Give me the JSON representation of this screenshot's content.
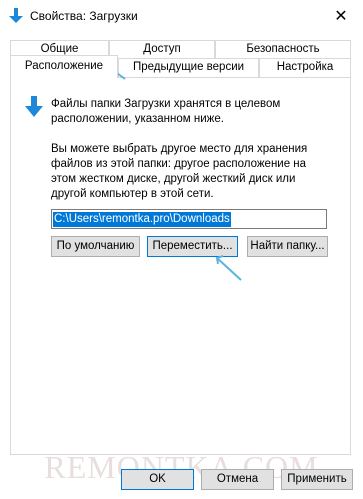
{
  "window": {
    "title": "Свойства: Загрузки",
    "close_glyph": "✕"
  },
  "tabs": {
    "row1": [
      "Общие",
      "Доступ",
      "Безопасность"
    ],
    "row2": [
      "Предыдущие версии",
      "Настройка"
    ],
    "active": "Расположение"
  },
  "content": {
    "info": "Файлы папки Загрузки хранятся в целевом расположении, указанном ниже.",
    "description": "Вы можете выбрать другое место для хранения файлов из этой папки: другое расположение на этом жестком диске, другой жесткий диск или другой компьютер в этой сети.",
    "path_value": "C:\\Users\\remontka.pro\\Downloads"
  },
  "buttons": {
    "default": "По умолчанию",
    "move": "Переместить...",
    "find": "Найти папку..."
  },
  "footer": {
    "ok": "OK",
    "cancel": "Отмена",
    "apply": "Применить"
  },
  "watermark": "REMONTKA.COM",
  "colors": {
    "accent": "#0078d7",
    "annotation": "#5ab4e0",
    "folder_blue": "#1e88d8"
  }
}
